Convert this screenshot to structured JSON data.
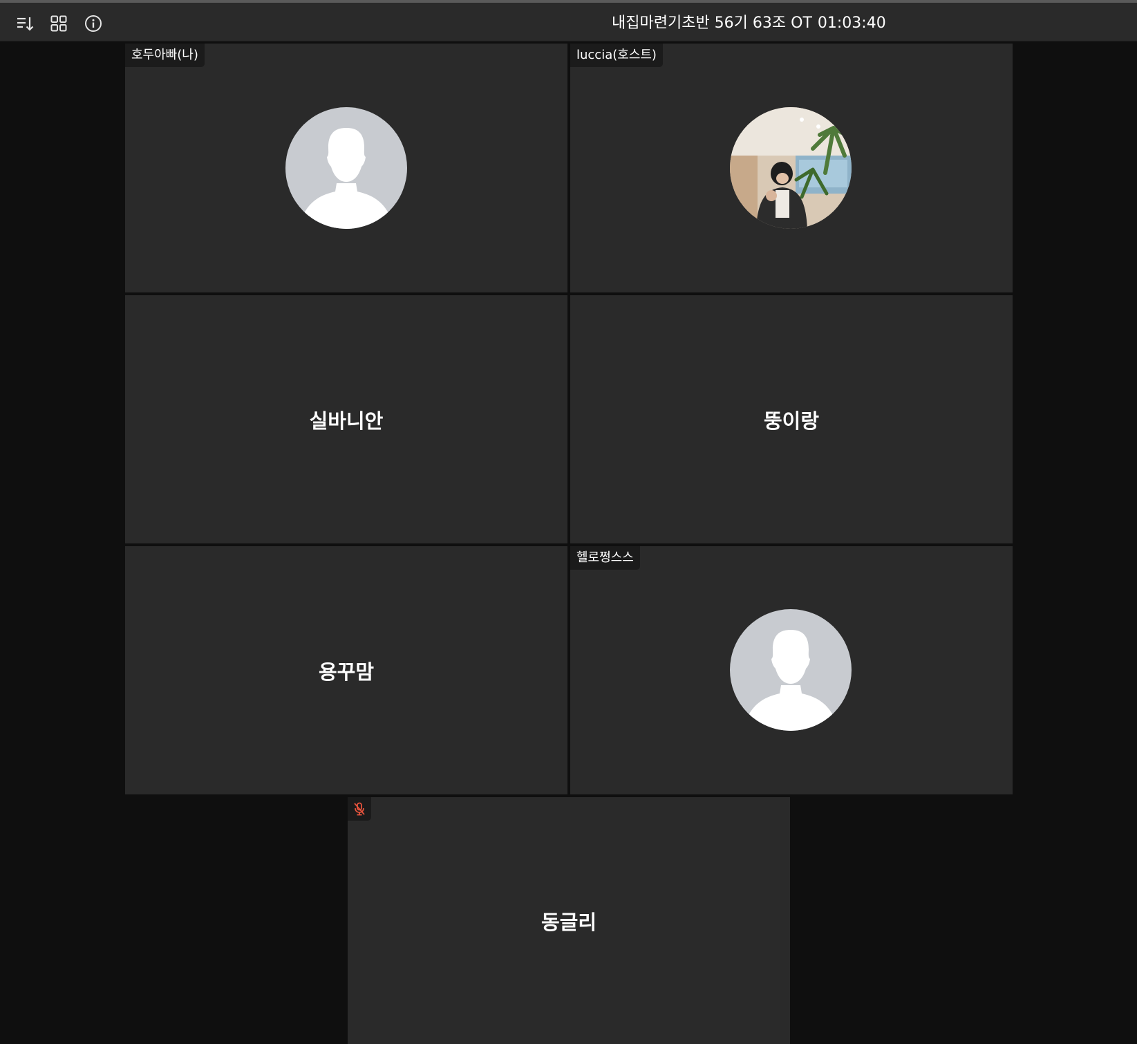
{
  "toolbar": {
    "icons": [
      "sort-icon",
      "grid-view-icon",
      "info-icon"
    ],
    "meeting_title": "내집마련기초반 56기 63조 OT",
    "timer": "01:03:40"
  },
  "participants": [
    {
      "tag": "호두아빠(나)",
      "display": "avatar-placeholder"
    },
    {
      "tag": "luccia(호스트)",
      "display": "profile-photo"
    },
    {
      "name": "실바니안",
      "display": "name"
    },
    {
      "name": "뚱이랑",
      "display": "name"
    },
    {
      "name": "용꾸맘",
      "display": "name"
    },
    {
      "tag": "헬로쩡스스",
      "display": "avatar-placeholder"
    },
    {
      "name": "동글리",
      "display": "name",
      "muted": true
    }
  ],
  "colors": {
    "background": "#0f0f0f",
    "toolbar": "#2a2a2a",
    "tile": "#2a2a2a",
    "name_tag": "#1b1b1b",
    "avatar_bg": "#c8cbd0",
    "muted_icon": "#e5533d"
  }
}
